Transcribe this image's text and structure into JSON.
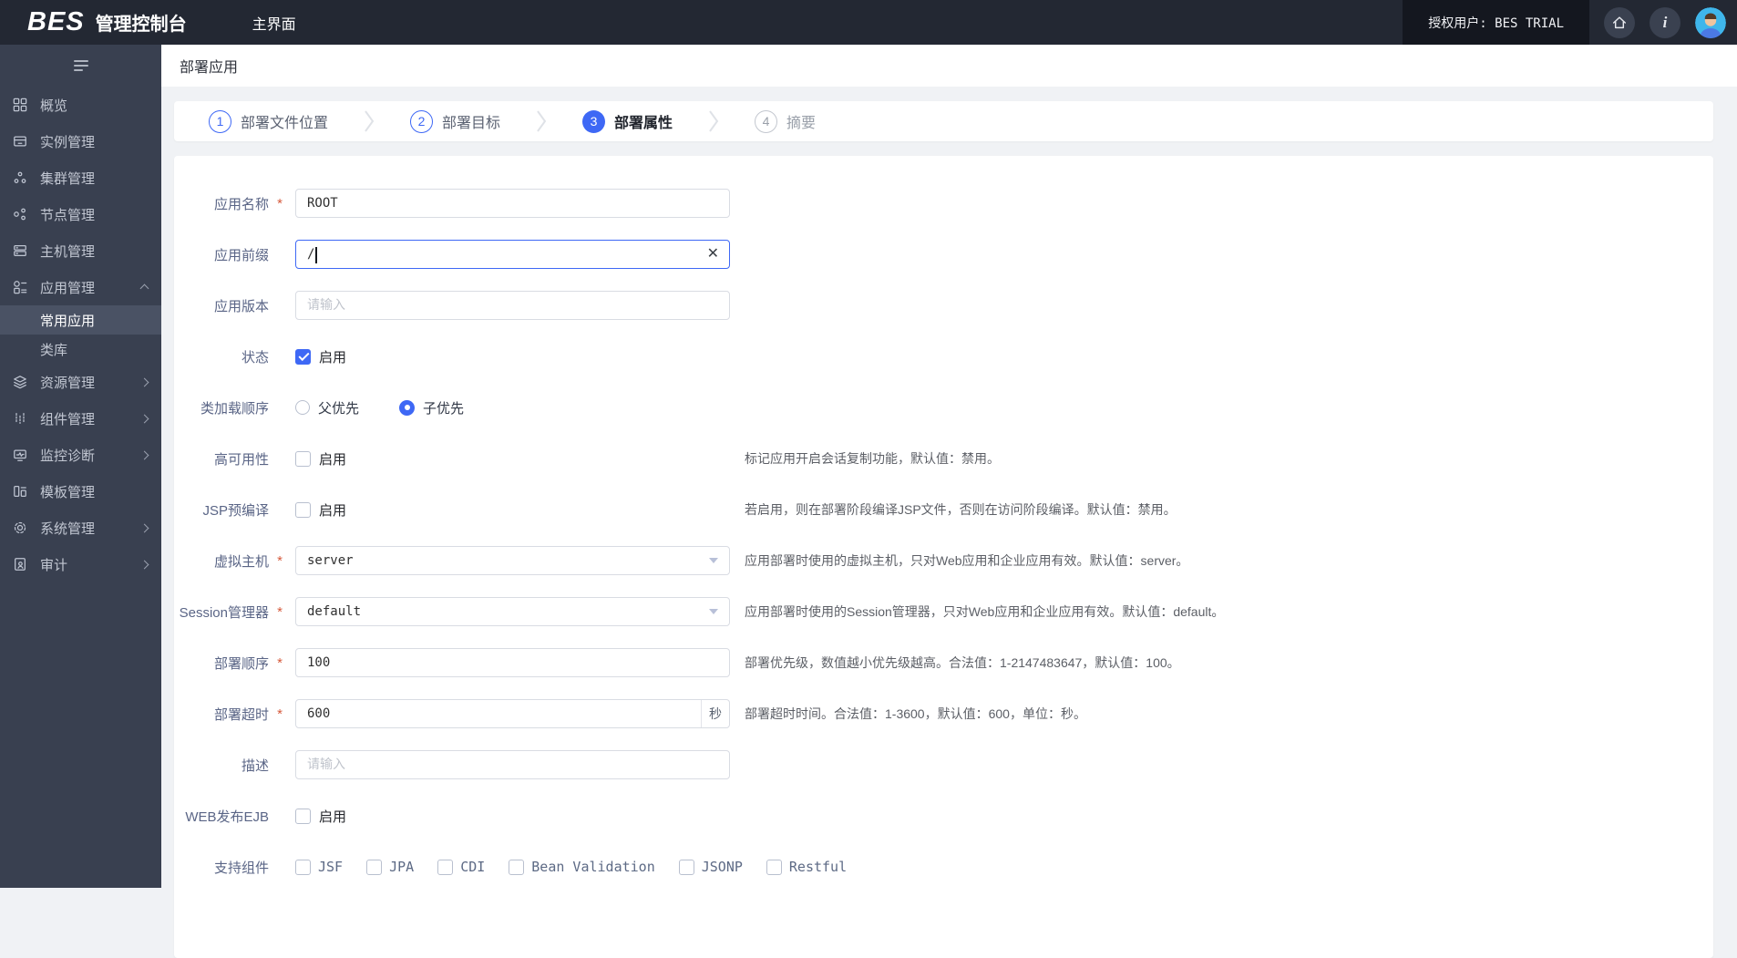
{
  "topbar": {
    "logo": "BES",
    "logo_suffix": "管理控制台",
    "tab": "主界面",
    "licensed_user": "授权用户: BES TRIAL"
  },
  "icons": {
    "info": "i",
    "clear": "✕"
  },
  "sidebar": {
    "items": [
      {
        "label": "概览"
      },
      {
        "label": "实例管理"
      },
      {
        "label": "集群管理"
      },
      {
        "label": "节点管理"
      },
      {
        "label": "主机管理"
      },
      {
        "label": "应用管理"
      },
      {
        "label": "常用应用"
      },
      {
        "label": "类库"
      },
      {
        "label": "资源管理"
      },
      {
        "label": "组件管理"
      },
      {
        "label": "监控诊断"
      },
      {
        "label": "模板管理"
      },
      {
        "label": "系统管理"
      },
      {
        "label": "审计"
      }
    ]
  },
  "page": {
    "title": "部署应用"
  },
  "stepper": [
    {
      "num": "1",
      "label": "部署文件位置"
    },
    {
      "num": "2",
      "label": "部署目标"
    },
    {
      "num": "3",
      "label": "部署属性"
    },
    {
      "num": "4",
      "label": "摘要"
    }
  ],
  "form": {
    "required_mark": "*",
    "app_name": {
      "label": "应用名称",
      "value": "ROOT"
    },
    "app_prefix": {
      "label": "应用前缀",
      "value": "/"
    },
    "app_version": {
      "label": "应用版本",
      "placeholder": "请输入"
    },
    "status": {
      "label": "状态",
      "checkbox_label": "启用"
    },
    "classload_order": {
      "label": "类加载顺序",
      "options": [
        {
          "label": "父优先"
        },
        {
          "label": "子优先"
        }
      ]
    },
    "high_availability": {
      "label": "高可用性",
      "checkbox_label": "启用",
      "hint": "标记应用开启会话复制功能，默认值：禁用。"
    },
    "jsp_precompile": {
      "label": "JSP预编译",
      "checkbox_label": "启用",
      "hint": "若启用，则在部署阶段编译JSP文件，否则在访问阶段编译。默认值：禁用。"
    },
    "virtual_host": {
      "label": "虚拟主机",
      "value": "server",
      "hint": "应用部署时使用的虚拟主机，只对Web应用和企业应用有效。默认值：server。"
    },
    "session_manager": {
      "label": "Session管理器",
      "value": "default",
      "hint": "应用部署时使用的Session管理器，只对Web应用和企业应用有效。默认值：default。"
    },
    "deploy_order": {
      "label": "部署顺序",
      "value": "100",
      "hint": "部署优先级，数值越小优先级越高。合法值：1-2147483647，默认值：100。"
    },
    "deploy_timeout": {
      "label": "部署超时",
      "value": "600",
      "unit": "秒",
      "hint": "部署超时时间。合法值：1-3600，默认值：600，单位：秒。"
    },
    "description": {
      "label": "描述",
      "placeholder": "请输入"
    },
    "web_publish_ejb": {
      "label": "WEB发布EJB",
      "checkbox_label": "启用"
    },
    "components": {
      "label": "支持组件",
      "options": [
        "JSF",
        "JPA",
        "CDI",
        "Bean Validation",
        "JSONP",
        "Restful"
      ]
    }
  }
}
